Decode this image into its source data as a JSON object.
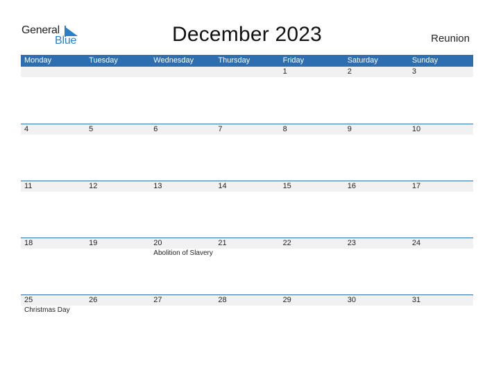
{
  "logo": {
    "general": "General",
    "blue": "Blue"
  },
  "title": "December 2023",
  "region": "Reunion",
  "weekdays": [
    "Monday",
    "Tuesday",
    "Wednesday",
    "Thursday",
    "Friday",
    "Saturday",
    "Sunday"
  ],
  "weeks": [
    {
      "days": [
        "",
        "",
        "",
        "",
        "1",
        "2",
        "3"
      ],
      "events": [
        "",
        "",
        "",
        "",
        "",
        "",
        ""
      ]
    },
    {
      "days": [
        "4",
        "5",
        "6",
        "7",
        "8",
        "9",
        "10"
      ],
      "events": [
        "",
        "",
        "",
        "",
        "",
        "",
        ""
      ]
    },
    {
      "days": [
        "11",
        "12",
        "13",
        "14",
        "15",
        "16",
        "17"
      ],
      "events": [
        "",
        "",
        "",
        "",
        "",
        "",
        ""
      ]
    },
    {
      "days": [
        "18",
        "19",
        "20",
        "21",
        "22",
        "23",
        "24"
      ],
      "events": [
        "",
        "",
        "Abolition of Slavery",
        "",
        "",
        "",
        ""
      ]
    },
    {
      "days": [
        "25",
        "26",
        "27",
        "28",
        "29",
        "30",
        "31"
      ],
      "events": [
        "Christmas Day",
        "",
        "",
        "",
        "",
        "",
        ""
      ]
    }
  ],
  "colors": {
    "header_bg": "#2d6eb0",
    "date_row_bg": "#f1f1f1",
    "brand_blue": "#2a7fc9"
  }
}
